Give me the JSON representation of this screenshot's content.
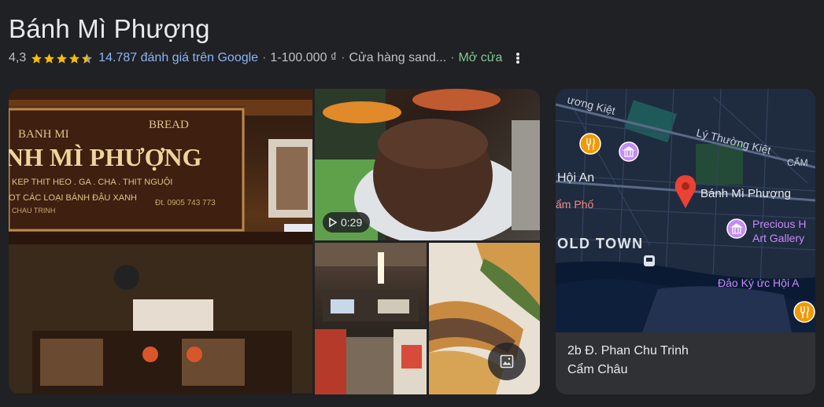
{
  "header": {
    "title": "Bánh Mì Phượng",
    "rating": "4,3",
    "reviews": "14.787 đánh giá trên Google",
    "price": "1-100.000 ₫",
    "category": "Cửa hàng sand...",
    "status": "Mở cửa"
  },
  "rating_value": 4.3,
  "gallery": {
    "sign_top_left": "BANH MI",
    "sign_top_right": "BREAD",
    "sign_main": "NH MÌ PHƯỢNG",
    "sign_line1": "KEP THIT HEO . GA . CHA . THIT NGUỘI",
    "sign_line2": "OT CÁC LOẠI   BÁNH ĐẬU XANH",
    "sign_line3": "CHAU TRINH",
    "sign_phone": "Đt. 0905 743 773",
    "video_duration": "0:29"
  },
  "map": {
    "labels": {
      "street_top": "ương Kiệt",
      "street_ly": "Lý Thường Kiệt",
      "hoi_an": "Hội An",
      "cam_pho": "ẩm Phố",
      "old_town": "OLD TOWN",
      "place": "Bánh Mì Phượng",
      "gallery1": "Precious H",
      "gallery2": "Art Gallery",
      "dao": "Đảo Ký ức Hội A",
      "cam_edge": "CẨM"
    },
    "address_line1": "2b Đ. Phan Chu Trinh",
    "address_line2": "Cẩm Châu",
    "colors": {
      "pin": "#ea4335",
      "poi": "#c58af9",
      "food": "#f29900",
      "water": "#0b1a33"
    }
  },
  "icons": [
    "star-icon",
    "kebab-icon",
    "play-icon",
    "photo-icon",
    "map-pin-icon",
    "museum-icon",
    "restaurant-icon",
    "bus-icon"
  ]
}
